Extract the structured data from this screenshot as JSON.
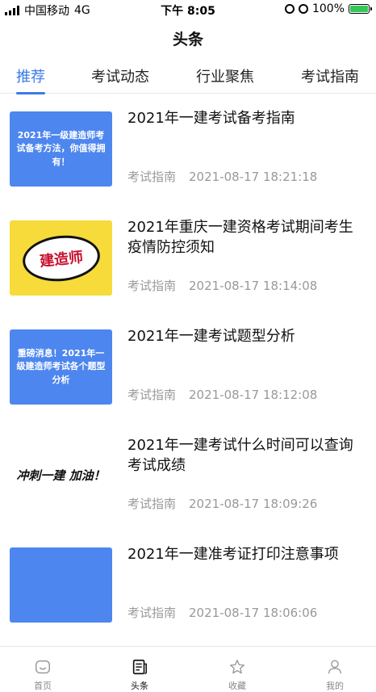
{
  "status_bar": {
    "carrier": "中国移动",
    "network": "4G",
    "time": "下午 8:05",
    "battery": "100%"
  },
  "nav": {
    "title": "头条"
  },
  "tabs": [
    {
      "label": "推荐",
      "active": true
    },
    {
      "label": "考试动态",
      "active": false
    },
    {
      "label": "行业聚焦",
      "active": false
    },
    {
      "label": "考试指南",
      "active": false
    }
  ],
  "articles": [
    {
      "thumb_text": "2021年一级建造师考试备考方法，你值得拥有！",
      "title": "2021年一建考试备考指南",
      "category": "考试指南",
      "datetime": "2021-08-17 18:21:18"
    },
    {
      "thumb_text": "建造师",
      "title": "2021年重庆一建资格考试期间考生疫情防控须知",
      "category": "考试指南",
      "datetime": "2021-08-17 18:14:08"
    },
    {
      "thumb_text": "重磅消息！2021年一级建造师考试各个题型分析",
      "title": "2021年一建考试题型分析",
      "category": "考试指南",
      "datetime": "2021-08-17 18:12:08"
    },
    {
      "thumb_text": "冲刺一建 加油！",
      "title": "2021年一建考试什么时间可以查询考试成绩",
      "category": "考试指南",
      "datetime": "2021-08-17 18:09:26"
    },
    {
      "thumb_text": "",
      "title": "2021年一建准考证打印注意事项",
      "category": "考试指南",
      "datetime": "2021-08-17 18:06:06"
    }
  ],
  "tabbar": [
    {
      "label": "首页",
      "icon": "home-icon",
      "active": false
    },
    {
      "label": "头条",
      "icon": "news-icon",
      "active": true
    },
    {
      "label": "收藏",
      "icon": "star-icon",
      "active": false
    },
    {
      "label": "我的",
      "icon": "profile-icon",
      "active": false
    }
  ],
  "colors": {
    "accent": "#3a7bea",
    "thumb_blue": "#4d86ee",
    "thumb_yellow": "#f6db3a",
    "meta": "#999999"
  }
}
